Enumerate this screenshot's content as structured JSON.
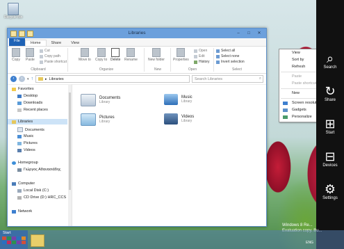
{
  "desktop": {
    "recycle_bin_label": "Recycle Bin"
  },
  "window": {
    "title": "Libraries",
    "tabs": [
      "File",
      "Home",
      "Share",
      "View"
    ],
    "active_tab": "Home",
    "ribbon": {
      "clipboard": {
        "copy": "Copy",
        "paste": "Paste",
        "cut": "Cut",
        "copy_path": "Copy path",
        "paste_shortcut": "Paste shortcut",
        "group": "Clipboard"
      },
      "organize": {
        "move_to": "Move to",
        "copy_to": "Copy to",
        "delete": "Delete",
        "rename": "Rename",
        "group": "Organize"
      },
      "new": {
        "new_folder": "New folder",
        "group": "New"
      },
      "open": {
        "properties": "Properties",
        "open": "Open",
        "edit": "Edit",
        "history": "History",
        "group": "Open"
      },
      "select": {
        "select_all": "Select all",
        "select_none": "Select none",
        "invert_selection": "Invert selection",
        "group": "Select"
      }
    },
    "address": {
      "path": "Libraries",
      "search_placeholder": "Search Libraries"
    },
    "nav": {
      "favorites": "Favorites",
      "favorites_items": [
        "Desktop",
        "Downloads",
        "Recent places"
      ],
      "libraries": "Libraries",
      "libraries_items": [
        "Documents",
        "Music",
        "Pictures",
        "Videos"
      ],
      "homegroup": "Homegroup",
      "homegroup_user": "Γιώργος Αθανασιάδης",
      "computer": "Computer",
      "computer_items": [
        "Local Disk (C:)",
        "CD Drive (D:) HRC_CCS"
      ],
      "network": "Network"
    },
    "libraries": [
      {
        "name": "Documents",
        "type": "Library"
      },
      {
        "name": "Music",
        "type": "Library"
      },
      {
        "name": "Pictures",
        "type": "Library"
      },
      {
        "name": "Videos",
        "type": "Library"
      }
    ]
  },
  "context_menu": {
    "items": [
      "View",
      "Sort by",
      "Refresh",
      "Paste",
      "Paste shortcut",
      "New",
      "Screen resolution",
      "Gadgets",
      "Personalize"
    ]
  },
  "charms": [
    "Search",
    "Share",
    "Start",
    "Devices",
    "Settings"
  ],
  "taskbar": {
    "start_label": "Start",
    "watermark_line1": "Windows 8 Re...",
    "watermark_line2": "Evaluation copy. Bu...",
    "language": "ENG"
  },
  "colors": {
    "accent": "#1f63b6",
    "titlebar": "#6ca0dc",
    "charms_bg": "#111111"
  }
}
